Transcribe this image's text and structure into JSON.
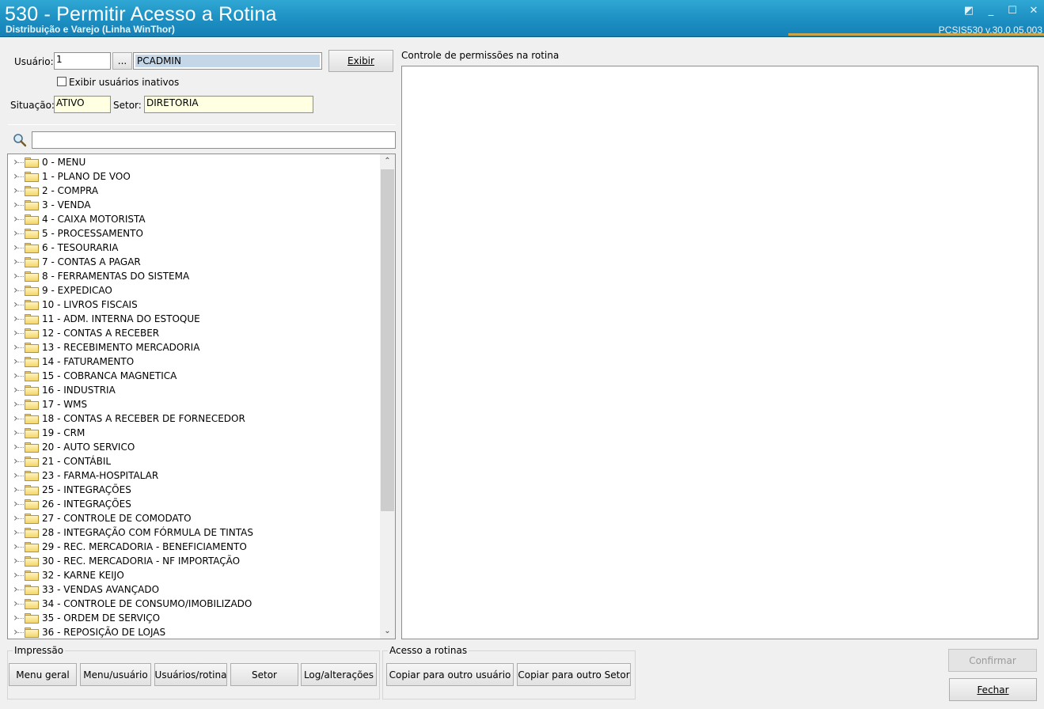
{
  "window": {
    "title": "530 - Permitir Acesso a Rotina",
    "subtitle": "Distribuição e Varejo (Linha WinThor)",
    "version": "PCSIS530  v.30.0.05.003"
  },
  "user_form": {
    "usuario_label": "Usuário:",
    "usuario_value": "1",
    "lookup_label": "...",
    "usuario_name": "PCADMIN",
    "exibir_label": "Exibir",
    "inactive_label": "Exibir usuários inativos",
    "situacao_label": "Situação:",
    "situacao_value": "ATIVO",
    "setor_label": "Setor:",
    "setor_value": "DIRETORIA"
  },
  "search": {
    "value": ""
  },
  "tree_items": [
    "0 - MENU",
    "1 - PLANO DE VOO",
    "2 - COMPRA",
    "3 - VENDA",
    "4 - CAIXA MOTORISTA",
    "5 - PROCESSAMENTO",
    "6 - TESOURARIA",
    "7 - CONTAS A PAGAR",
    "8 - FERRAMENTAS DO SISTEMA",
    "9 - EXPEDICAO",
    "10 - LIVROS FISCAIS",
    "11 - ADM. INTERNA DO ESTOQUE",
    "12 - CONTAS A RECEBER",
    "13 - RECEBIMENTO MERCADORIA",
    "14 - FATURAMENTO",
    "15 - COBRANCA MAGNETICA",
    "16 - INDUSTRIA",
    "17 - WMS",
    "18 - CONTAS A RECEBER DE FORNECEDOR",
    "19 - CRM",
    "20 - AUTO SERVICO",
    "21 - CONTÁBIL",
    "23 - FARMA-HOSPITALAR",
    "25 - INTEGRAÇÕES",
    "26 - INTEGRAÇÕES",
    "27 - CONTROLE DE COMODATO",
    "28 - INTEGRAÇÃO COM FÓRMULA DE TINTAS",
    "29 - REC. MERCADORIA - BENEFICIAMENTO",
    "30 - REC. MERCADORIA - NF IMPORTAÇÃO",
    "32 - KARNE KEIJO",
    "33 - VENDAS AVANÇADO",
    "34 - CONTROLE DE CONSUMO/IMOBILIZADO",
    "35 - ORDEM DE SERVIÇO",
    "36 - REPOSIÇÃO DE LOJAS"
  ],
  "permissions": {
    "label": "Controle de permissões na rotina"
  },
  "impressao": {
    "title": "Impressão",
    "menu_geral": "Menu geral",
    "menu_usuario": "Menu/usuário",
    "usuarios_rotina": "Usuários/rotina",
    "setor": "Setor",
    "log": "Log/alterações"
  },
  "acesso": {
    "title": "Acesso a rotinas",
    "copy_user": "Copiar para outro usuário",
    "copy_setor": "Copiar para outro Setor"
  },
  "actions": {
    "confirmar": "Confirmar",
    "fechar": "Fechar"
  }
}
